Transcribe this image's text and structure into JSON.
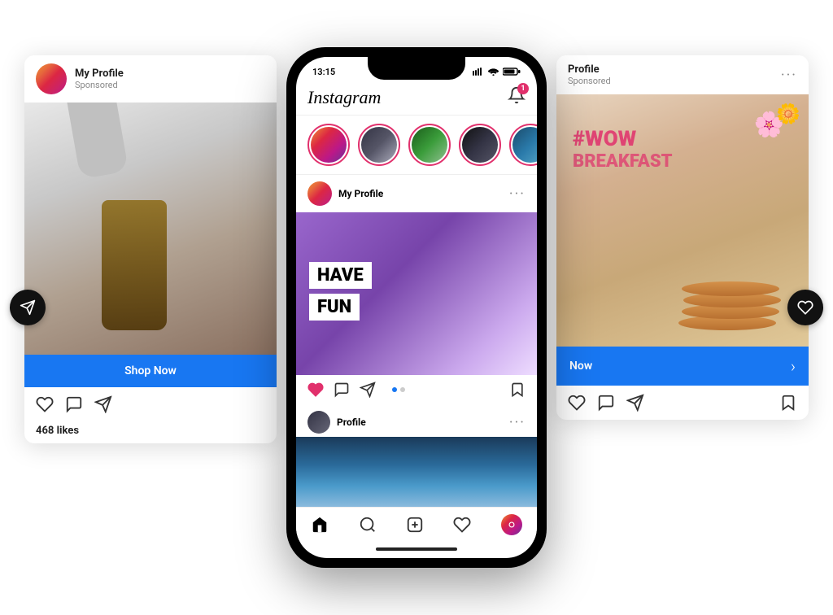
{
  "scene": {
    "background": "#ffffff"
  },
  "left_card": {
    "profile_name": "My Profile",
    "sponsored": "Sponsored",
    "shop_now": "Shop Now",
    "likes": "468 likes",
    "send_icon": "➤",
    "heart_icon": "♡",
    "comment_icon": "○",
    "share_icon": "➤"
  },
  "center_phone": {
    "status_time": "13:15",
    "ig_logo": "Instagram",
    "notification_count": "1",
    "post_profile": "My Profile",
    "post_text_line1": "HAVE",
    "post_text_line2": "FUN",
    "post2_profile": "Profile",
    "nav": {
      "home": "⌂",
      "search": "⊕",
      "add": "⊕",
      "heart": "♡",
      "camera": "●"
    }
  },
  "right_card": {
    "profile_name": "Profile",
    "sponsored": "Sponsored",
    "shop_now": "Now",
    "hashtag_line1": "#WOW",
    "hashtag_line2": "BREAKFAST",
    "heart_icon": "♡",
    "comment_icon": "○",
    "share_icon": "➤",
    "bookmark_icon": "⊟",
    "three_dots": "...",
    "chevron_right": "›"
  }
}
